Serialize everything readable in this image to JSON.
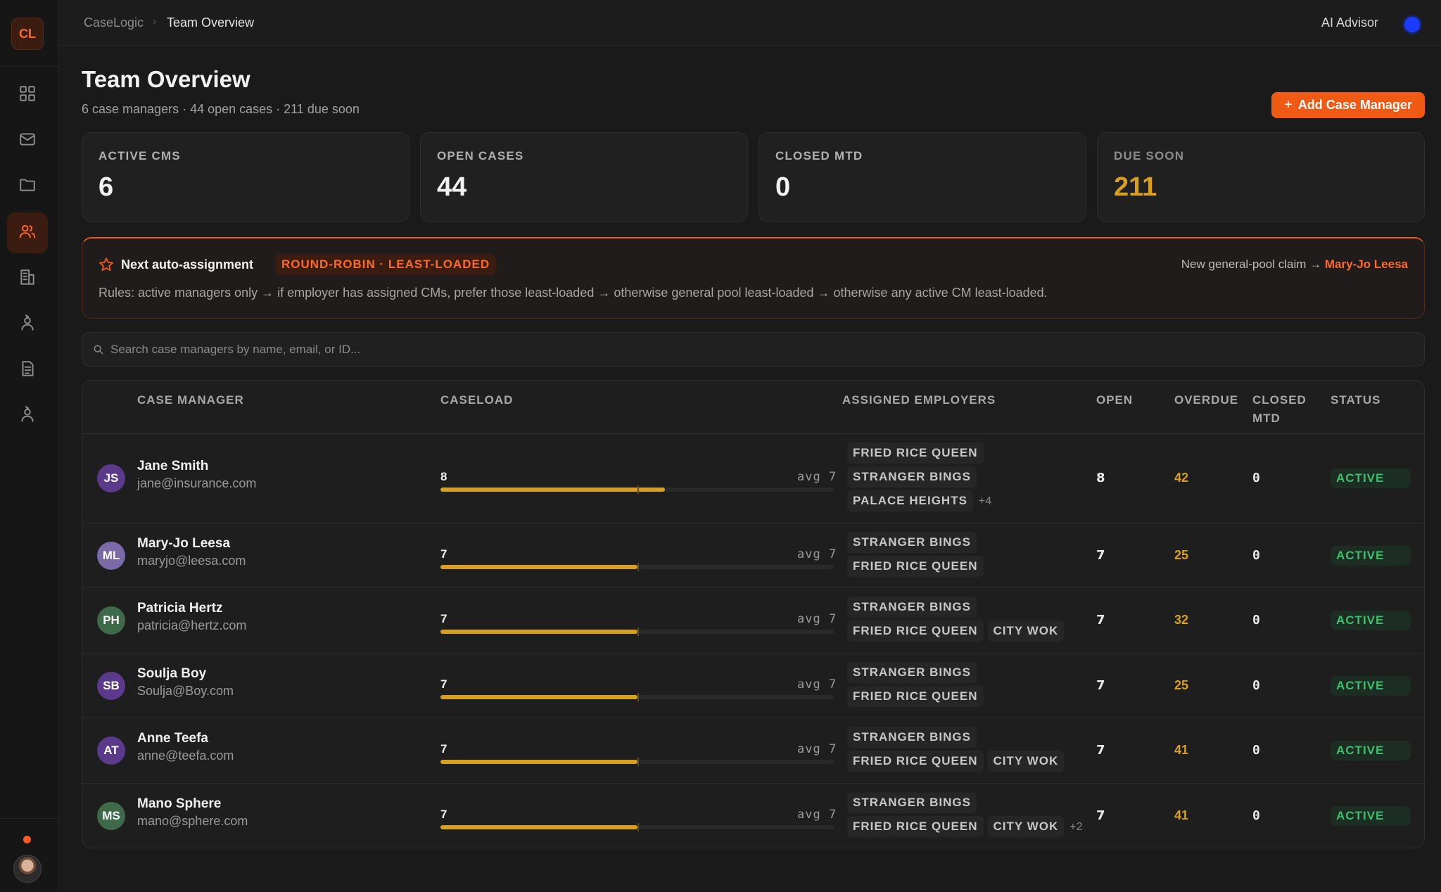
{
  "sidebar": {
    "logo": "CL",
    "nav": [
      {
        "icon": "grid-icon",
        "active": false
      },
      {
        "icon": "mail-icon",
        "active": false
      },
      {
        "icon": "folder-icon",
        "active": false
      },
      {
        "icon": "users-icon",
        "active": true
      },
      {
        "icon": "building-icon",
        "active": false
      },
      {
        "icon": "person-icon",
        "active": false
      },
      {
        "icon": "document-icon",
        "active": false
      },
      {
        "icon": "person-icon",
        "active": false
      }
    ]
  },
  "topbar": {
    "breadcrumb_root": "CaseLogic",
    "breadcrumb_sep": "›",
    "breadcrumb_current": "Team Overview",
    "ai_advisor": "AI Advisor"
  },
  "header": {
    "title": "Team Overview",
    "subtitle": "6 case managers · 44 open cases · 211 due soon",
    "add_button_plus": "+",
    "add_button_label": "Add Case Manager"
  },
  "stats": {
    "active_cms": {
      "label": "ACTIVE CMS",
      "value": "6"
    },
    "open_cases": {
      "label": "OPEN CASES",
      "value": "44"
    },
    "closed_mtd": {
      "label": "CLOSED MTD",
      "value": "0"
    },
    "due_soon": {
      "label": "DUE SOON",
      "value": "211",
      "color": "#d9a020"
    }
  },
  "banner": {
    "title": "Next auto-assignment",
    "badge": "ROUND-ROBIN · LEAST-LOADED",
    "right_prefix": "New general-pool claim →",
    "right_name": "Mary-Jo Leesa",
    "rules": "Rules: active managers only → if employer has assigned CMs, prefer those least-loaded → otherwise general pool least-loaded → otherwise any active CM least-loaded."
  },
  "search": {
    "placeholder": "Search case managers by name, email, or ID..."
  },
  "table": {
    "headers": {
      "case_manager": "CASE MANAGER",
      "caseload": "CASELOAD",
      "employers": "ASSIGNED EMPLOYERS",
      "open": "OPEN",
      "overdue": "OVERDUE",
      "closed_mtd_1": "CLOSED",
      "closed_mtd_2": "MTD",
      "status": "STATUS"
    },
    "rows": [
      {
        "initials": "JS",
        "avatar_color": "#5b3a8c",
        "name": "Jane Smith",
        "email": "jane@insurance.com",
        "caseload": 8,
        "caseload_label": "8",
        "avg_label": "avg 7",
        "employers_row1": [
          "FRIED RICE QUEEN"
        ],
        "employers_row2": [
          "STRANGER BINGS"
        ],
        "employers_row3": [
          "PALACE HEIGHTS"
        ],
        "more": "+4",
        "open": "8",
        "overdue": "42",
        "closed": "0",
        "status": "ACTIVE"
      },
      {
        "initials": "ML",
        "avatar_color": "#7a6aa8",
        "name": "Mary-Jo Leesa",
        "email": "maryjo@leesa.com",
        "caseload": 7,
        "caseload_label": "7",
        "avg_label": "avg 7",
        "employers_row1": [
          "STRANGER BINGS"
        ],
        "employers_row2": [
          "FRIED RICE QUEEN"
        ],
        "more": "",
        "open": "7",
        "overdue": "25",
        "closed": "0",
        "status": "ACTIVE"
      },
      {
        "initials": "PH",
        "avatar_color": "#3f6a4a",
        "name": "Patricia Hertz",
        "email": "patricia@hertz.com",
        "caseload": 7,
        "caseload_label": "7",
        "avg_label": "avg 7",
        "employers_row1": [
          "STRANGER BINGS"
        ],
        "employers_row2": [
          "FRIED RICE QUEEN",
          "CITY WOK"
        ],
        "more": "",
        "open": "7",
        "overdue": "32",
        "closed": "0",
        "status": "ACTIVE"
      },
      {
        "initials": "SB",
        "avatar_color": "#5b3a8c",
        "name": "Soulja Boy",
        "email": "Soulja@Boy.com",
        "caseload": 7,
        "caseload_label": "7",
        "avg_label": "avg 7",
        "employers_row1": [
          "STRANGER BINGS"
        ],
        "employers_row2": [
          "FRIED RICE QUEEN"
        ],
        "more": "",
        "open": "7",
        "overdue": "25",
        "closed": "0",
        "status": "ACTIVE"
      },
      {
        "initials": "AT",
        "avatar_color": "#5b3a8c",
        "name": "Anne Teefa",
        "email": "anne@teefa.com",
        "caseload": 7,
        "caseload_label": "7",
        "avg_label": "avg 7",
        "employers_row1": [
          "STRANGER BINGS"
        ],
        "employers_row2": [
          "FRIED RICE QUEEN",
          "CITY WOK"
        ],
        "more": "",
        "open": "7",
        "overdue": "41",
        "closed": "0",
        "status": "ACTIVE"
      },
      {
        "initials": "MS",
        "avatar_color": "#3f6a4a",
        "name": "Mano Sphere",
        "email": "mano@sphere.com",
        "caseload": 7,
        "caseload_label": "7",
        "avg_label": "avg 7",
        "employers_row1": [
          "STRANGER BINGS"
        ],
        "employers_row2": [
          "FRIED RICE QUEEN",
          "CITY WOK"
        ],
        "more": "+2",
        "open": "7",
        "overdue": "41",
        "closed": "0",
        "status": "ACTIVE"
      }
    ],
    "caseload_scale_max": 14,
    "caseload_avg": 7
  },
  "colors": {
    "accent": "#f05a14",
    "warning": "#d9a020",
    "success": "#3fbf6a",
    "ai_dot": "#1a3cff"
  }
}
